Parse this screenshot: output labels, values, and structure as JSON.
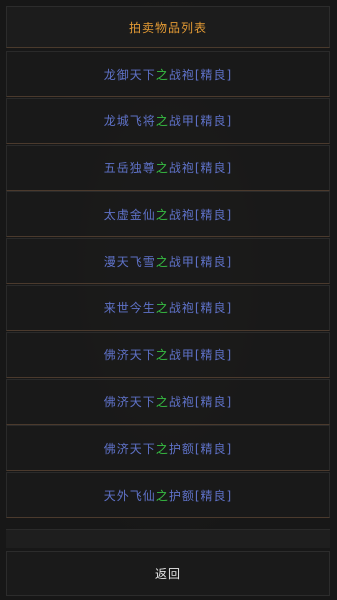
{
  "header": {
    "title": "拍卖物品列表"
  },
  "items": [
    {
      "pre": "龙御天下",
      "zhi": "之",
      "post": "战袍[精良]"
    },
    {
      "pre": "龙城飞将",
      "zhi": "之",
      "post": "战甲[精良]"
    },
    {
      "pre": "五岳独尊",
      "zhi": "之",
      "post": "战袍[精良]"
    },
    {
      "pre": "太虚金仙",
      "zhi": "之",
      "post": "战袍[精良]"
    },
    {
      "pre": "漫天飞雪",
      "zhi": "之",
      "post": "战甲[精良]"
    },
    {
      "pre": "来世今生",
      "zhi": "之",
      "post": "战袍[精良]"
    },
    {
      "pre": "佛济天下",
      "zhi": "之",
      "post": "战甲[精良]"
    },
    {
      "pre": "佛济天下",
      "zhi": "之",
      "post": "战袍[精良]"
    },
    {
      "pre": "佛济天下",
      "zhi": "之",
      "post": "护额[精良]"
    },
    {
      "pre": "天外飞仙",
      "zhi": "之",
      "post": "护额[精良]"
    }
  ],
  "footer": {
    "back_label": "返回"
  },
  "colors": {
    "title": "#e39a34",
    "item_name": "#5f72c8",
    "connector": "#37c043",
    "back_text": "#e8e8e8",
    "background": "#171717"
  }
}
